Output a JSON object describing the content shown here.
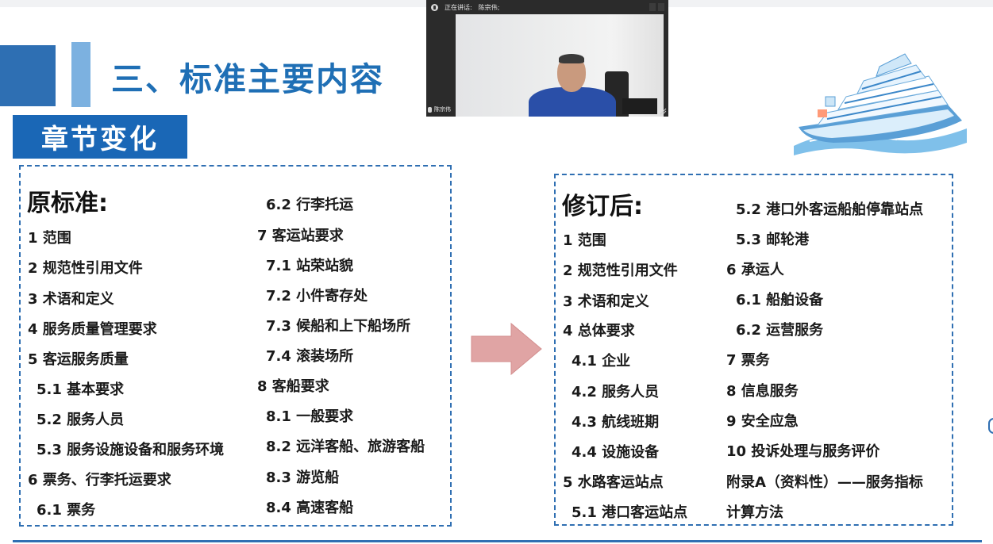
{
  "slide": {
    "section_title": "三、标准主要内容",
    "chapter_banner": "章节变化"
  },
  "video_call": {
    "status_label": "正在讲话:",
    "speaker_name": "陈宗伟;",
    "participant_name": "陈宗伟",
    "icons": [
      "mic-icon",
      "menu-icon",
      "resize-icon"
    ]
  },
  "left_panel": {
    "heading": "原标准:",
    "items": [
      "1 范围",
      "2 规范性引用文件",
      "3 术语和定义",
      "4 服务质量管理要求",
      "5 客运服务质量",
      "5.1 基本要求",
      "5.2 服务人员",
      "5.3 服务设施设备和服务环境",
      "6 票务、行李托运要求",
      "6.1 票务",
      "6.2 行李托运",
      "7 客运站要求",
      "7.1 站荣站貌",
      "7.2 小件寄存处",
      "7.3 候船和上下船场所",
      "7.4 滚装场所",
      "8 客船要求",
      "8.1 一般要求",
      "8.2 远洋客船、旅游客船",
      "8.3 游览船",
      "8.4 高速客船"
    ]
  },
  "right_panel": {
    "heading": "修订后:",
    "items": [
      "1 范围",
      "2 规范性引用文件",
      "3 术语和定义",
      "4 总体要求",
      "4.1 企业",
      "4.2 服务人员",
      "4.3 航线班期",
      "4.4 设施设备",
      "5 水路客运站点",
      "5.1 港口客运站点",
      "5.2 港口外客运船舶停靠站点",
      "5.3 邮轮港",
      "6 承运人",
      "6.1 船舶设备",
      "6.2 运营服务",
      "7 票务",
      "8 信息服务",
      "9 安全应急",
      "10 投诉处理与服务评价",
      "附录A（资料性）——服务指标",
      "计算方法"
    ]
  },
  "colors": {
    "title_blue": "#1f6fb5",
    "banner_blue": "#1a67b6",
    "box_border": "#2f6fb2",
    "arrow_fill": "#e0a4a4"
  }
}
